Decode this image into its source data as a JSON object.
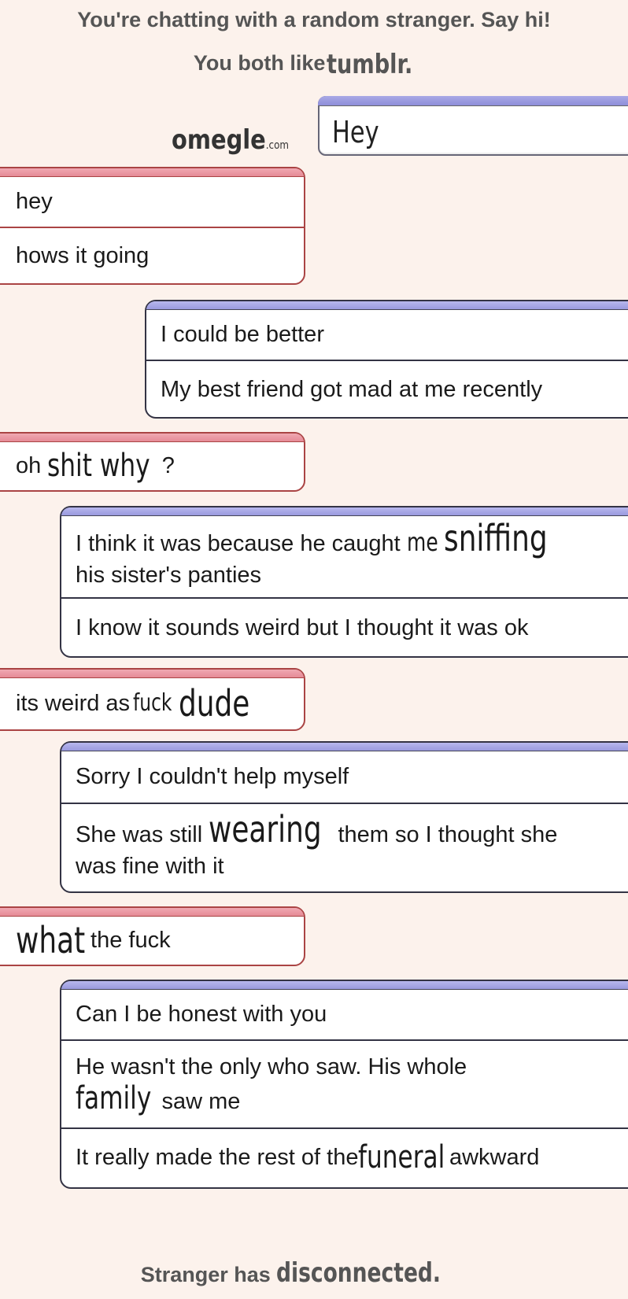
{
  "header": {
    "intro": "You're chatting with a random stranger. Say hi!",
    "likes_prefix": "You both like",
    "likes_logo": "tumblr."
  },
  "compose": {
    "logo_main": "omegle",
    "logo_suffix": ".com",
    "input_value": "Hey"
  },
  "messages": [
    {
      "from": "stranger",
      "lines": [
        "hey",
        "hows it going"
      ]
    },
    {
      "from": "you",
      "lines": [
        "I could be better",
        "My best friend got mad at me recently"
      ]
    },
    {
      "from": "stranger",
      "parts": [
        "oh ",
        "shit why",
        "?"
      ]
    },
    {
      "from": "you",
      "line1_parts": [
        "I think it was because he caught ",
        "me",
        "sniffing"
      ],
      "line1_rest": "his sister's panties",
      "line2": "I know it sounds weird but I thought it was ok"
    },
    {
      "from": "stranger",
      "parts": [
        "its weird as ",
        "fuck",
        "dude"
      ]
    },
    {
      "from": "you",
      "line1": "Sorry I couldn't help myself",
      "line2_parts": [
        "She was still ",
        "wearing",
        " them so I thought she"
      ],
      "line2_rest": "was fine with it"
    },
    {
      "from": "stranger",
      "parts": [
        "what",
        "the fuck"
      ]
    },
    {
      "from": "you",
      "line1": "Can I be honest with you",
      "line2": "He wasn't the only who saw. His whole",
      "line2_parts": [
        "family",
        "saw me"
      ],
      "line3_parts": [
        "It really made the rest of the ",
        "funeral",
        " awkward"
      ]
    }
  ],
  "footer": {
    "prefix": "Stranger has ",
    "word": "disconnected."
  },
  "colors": {
    "background": "#fcf2ec",
    "stranger_accent": "#e58a96",
    "you_accent": "#9999de"
  }
}
